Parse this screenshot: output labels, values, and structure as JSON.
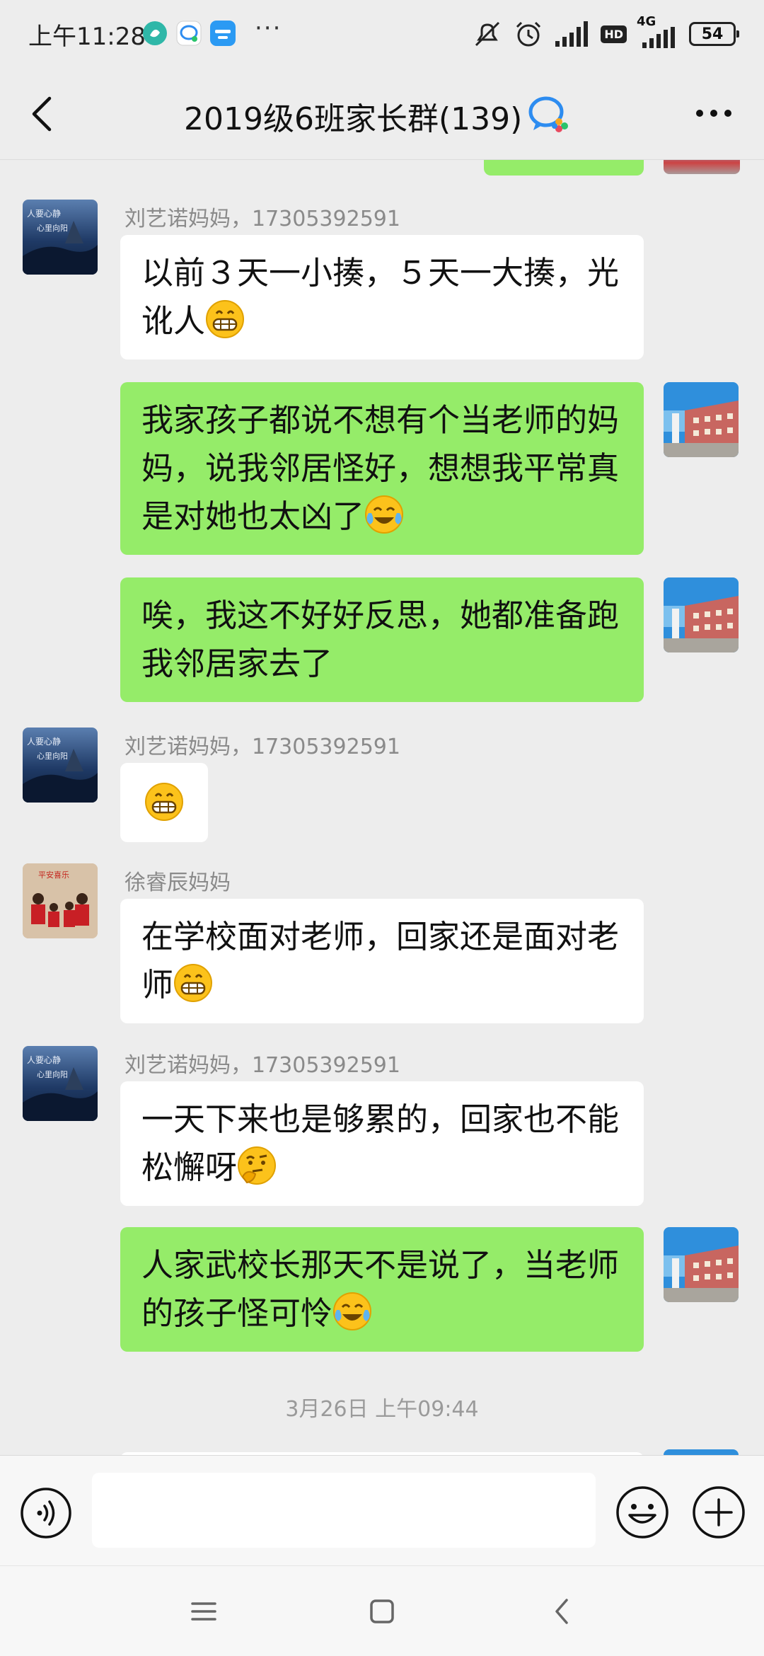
{
  "status_bar": {
    "time": "上午11:28",
    "more": "···",
    "battery": "54",
    "signal_label": "4G",
    "hd_label": "HD"
  },
  "nav": {
    "title": "2019级6班家长群(139)"
  },
  "messages": [
    {
      "type": "in",
      "sender": "刘艺诺妈妈，17305392591",
      "text": "以前３天一小揍，５天一大揍，光讹人",
      "emoji": "grin"
    },
    {
      "type": "out",
      "text": "我家孩子都说不想有个当老师的妈妈，说我邻居怪好，想想我平常真是对她也太凶了",
      "emoji": "laugh-cry"
    },
    {
      "type": "out",
      "text": "唉，我这不好好反思，她都准备跑我邻居家去了"
    },
    {
      "type": "in",
      "sender": "刘艺诺妈妈，17305392591",
      "text": "",
      "emoji": "grin"
    },
    {
      "type": "in",
      "sender": "徐睿辰妈妈",
      "text": "在学校面对老师，回家还是面对老师",
      "emoji": "grin"
    },
    {
      "type": "in",
      "sender": "刘艺诺妈妈，17305392591",
      "text": "一天下来也是够累的，回家也不能松懈呀",
      "emoji": "thinking"
    },
    {
      "type": "out",
      "text": "人家武校长那天不是说了，当老师的孩子怪可怜",
      "emoji": "laugh-cry"
    }
  ],
  "timestamp": "3月26日 上午09:44",
  "input": {
    "value": ""
  },
  "colors": {
    "background": "#ededed",
    "outgoing_bubble": "#95ec69",
    "incoming_bubble": "#ffffff"
  }
}
